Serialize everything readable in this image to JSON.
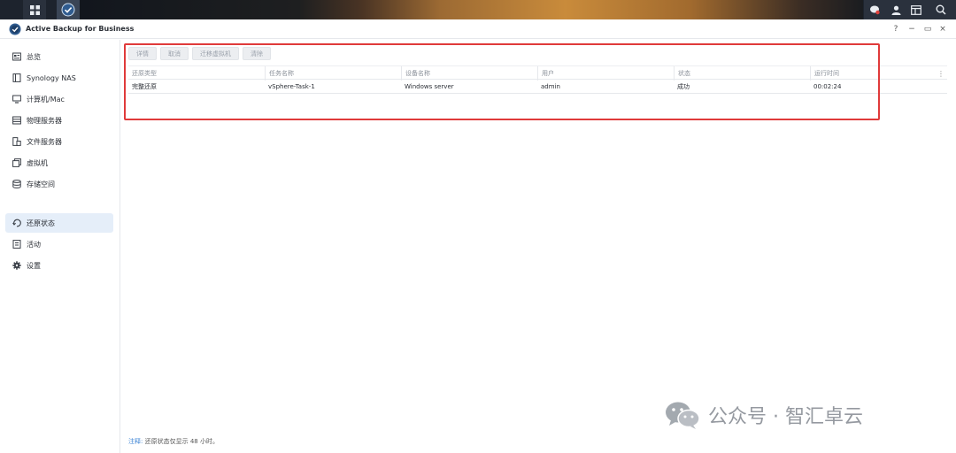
{
  "window": {
    "title": "Active Backup for Business",
    "controls": [
      "?",
      "−",
      "▭",
      "×"
    ]
  },
  "sidebar": {
    "items": [
      {
        "label": "总览",
        "icon": "overview-icon"
      },
      {
        "label": "Synology NAS",
        "icon": "nas-icon"
      },
      {
        "label": "计算机/Mac",
        "icon": "computer-icon"
      },
      {
        "label": "物理服务器",
        "icon": "server-icon"
      },
      {
        "label": "文件服务器",
        "icon": "file-server-icon"
      },
      {
        "label": "虚拟机",
        "icon": "vm-icon"
      },
      {
        "label": "存储空间",
        "icon": "storage-icon"
      },
      {
        "label": "还原状态",
        "icon": "restore-icon",
        "active": true
      },
      {
        "label": "活动",
        "icon": "activity-icon"
      },
      {
        "label": "设置",
        "icon": "gear-icon"
      }
    ]
  },
  "toolbar": {
    "details": "详情",
    "cancel": "取消",
    "migrate_vm": "迁移虚拟机",
    "clear": "清除"
  },
  "table": {
    "headers": {
      "restore_type": "还原类型",
      "task_name": "任务名称",
      "device_name": "设备名称",
      "user": "用户",
      "status": "状态",
      "run_time": "运行时间"
    },
    "rows": [
      {
        "restore_type": "完整还原",
        "task_name": "vSphere-Task-1",
        "device_name": "Windows server",
        "user": "admin",
        "status": "成功",
        "run_time": "00:02:24"
      }
    ]
  },
  "footer": {
    "note_label": "注释:",
    "note_text": "还原状态仅显示 48 小时。"
  },
  "watermark": {
    "text": "公众号 · 智汇卓云"
  },
  "colors": {
    "accent": "#3f86d6",
    "active_nav_bg": "#e5eef9",
    "highlight": "#e03a3a"
  }
}
